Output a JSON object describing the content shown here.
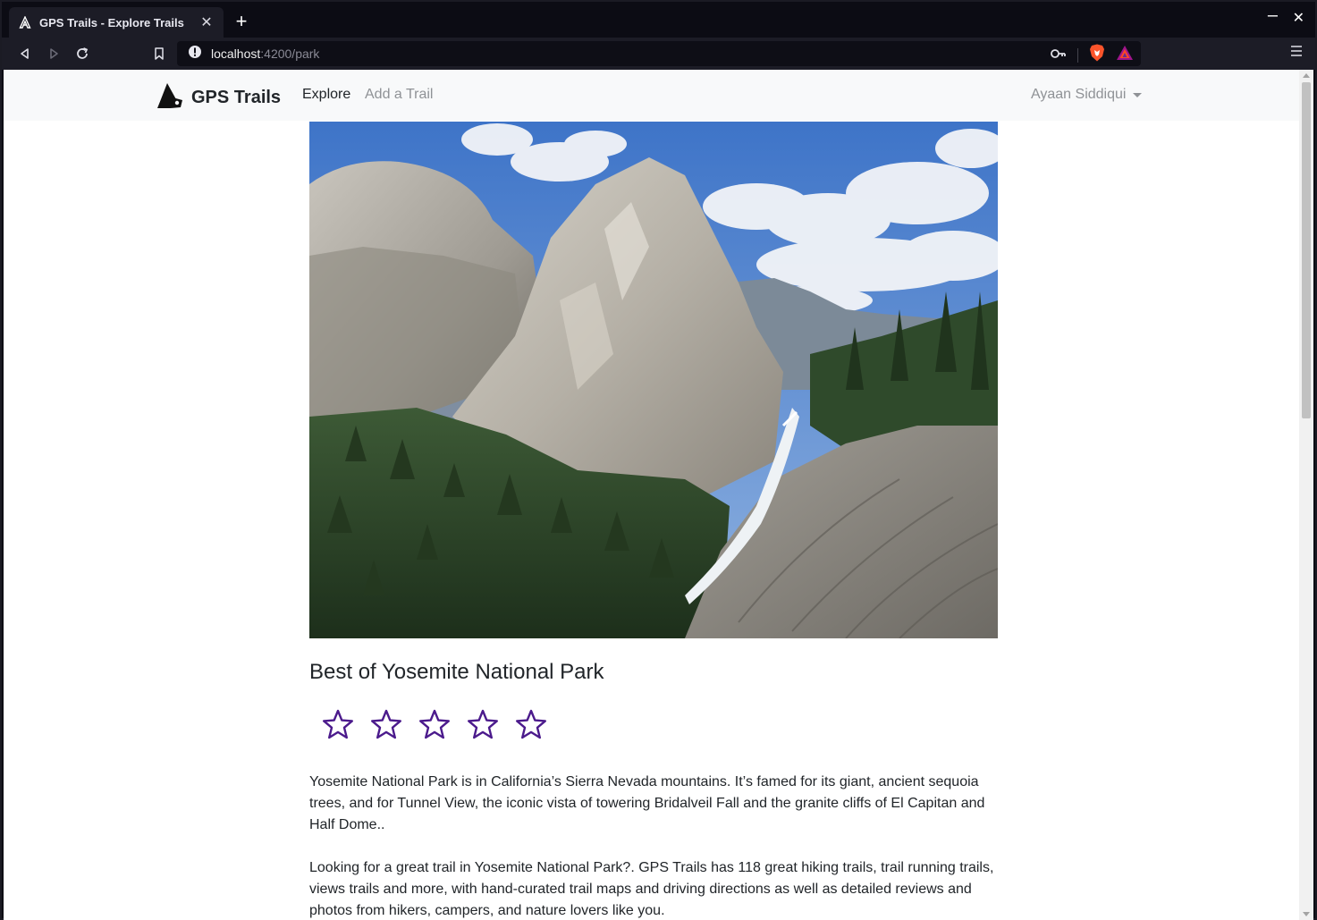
{
  "browser": {
    "tab_title": "GPS Trails - Explore Trails",
    "tab_close": "✕",
    "new_tab": "+",
    "url_host": "localhost",
    "url_rest": ":4200/park",
    "minimize": "–",
    "close": "✕"
  },
  "navbar": {
    "brand": "GPS Trails",
    "links": [
      "Explore",
      "Add a Trail"
    ],
    "user": "Ayaan Siddiqui"
  },
  "park": {
    "title": "Best of Yosemite National Park",
    "rating": {
      "value": 0,
      "max": 5,
      "star_color": "#4b1a8c"
    },
    "description_1": "Yosemite National Park is in California’s Sierra Nevada mountains. It’s famed for its giant, ancient sequoia trees, and for Tunnel View, the iconic vista of towering Bridalveil Fall and the granite cliffs of El Capitan and Half Dome..",
    "description_2": "Looking for a great trail in Yosemite National Park?. GPS Trails has 118 great hiking trails, trail running trails, views trails and more, with hand-curated trail maps and driving directions as well as detailed reviews and photos from hikers, campers, and nature lovers like you."
  },
  "icons": {
    "favicon": "angular-icon",
    "back": "back-arrow-icon",
    "forward": "forward-arrow-icon",
    "reload": "reload-icon",
    "bookmark": "bookmark-icon",
    "site_info": "info-icon",
    "key": "key-icon",
    "brave": "brave-shield-icon",
    "rewards": "brave-rewards-icon",
    "menu": "hamburger-menu-icon",
    "brand": "mountain-logo-icon"
  }
}
